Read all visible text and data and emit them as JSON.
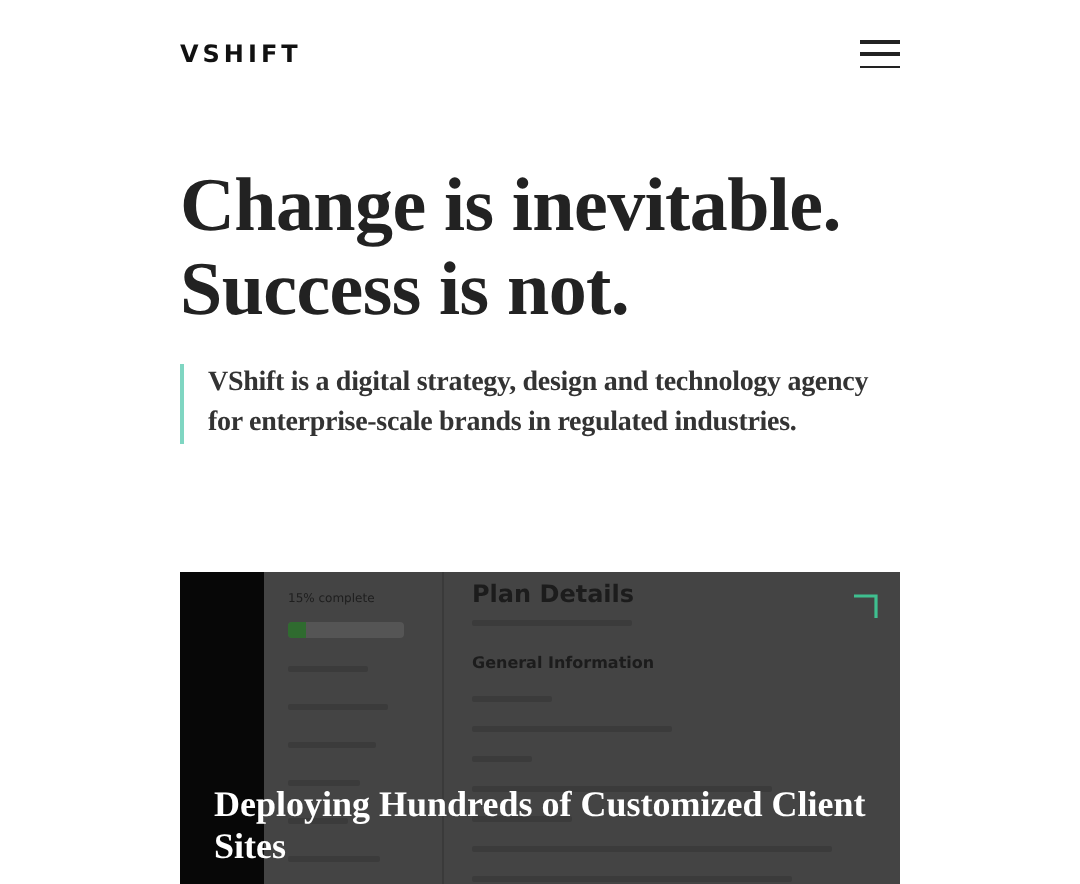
{
  "header": {
    "logo": "VSHIFT"
  },
  "hero": {
    "heading": "Change is inevitable. Success is not.",
    "intro": "VShift is a digital strategy, design and technology agency for enterprise-scale brands in regulated industries."
  },
  "featured_card": {
    "title": "Deploying Hundreds of Customized Client Sites",
    "screenshot": {
      "progress": {
        "label": "15% complete",
        "level": 0.15
      },
      "page_title": "Plan Details",
      "section_title": "General Information"
    }
  }
}
